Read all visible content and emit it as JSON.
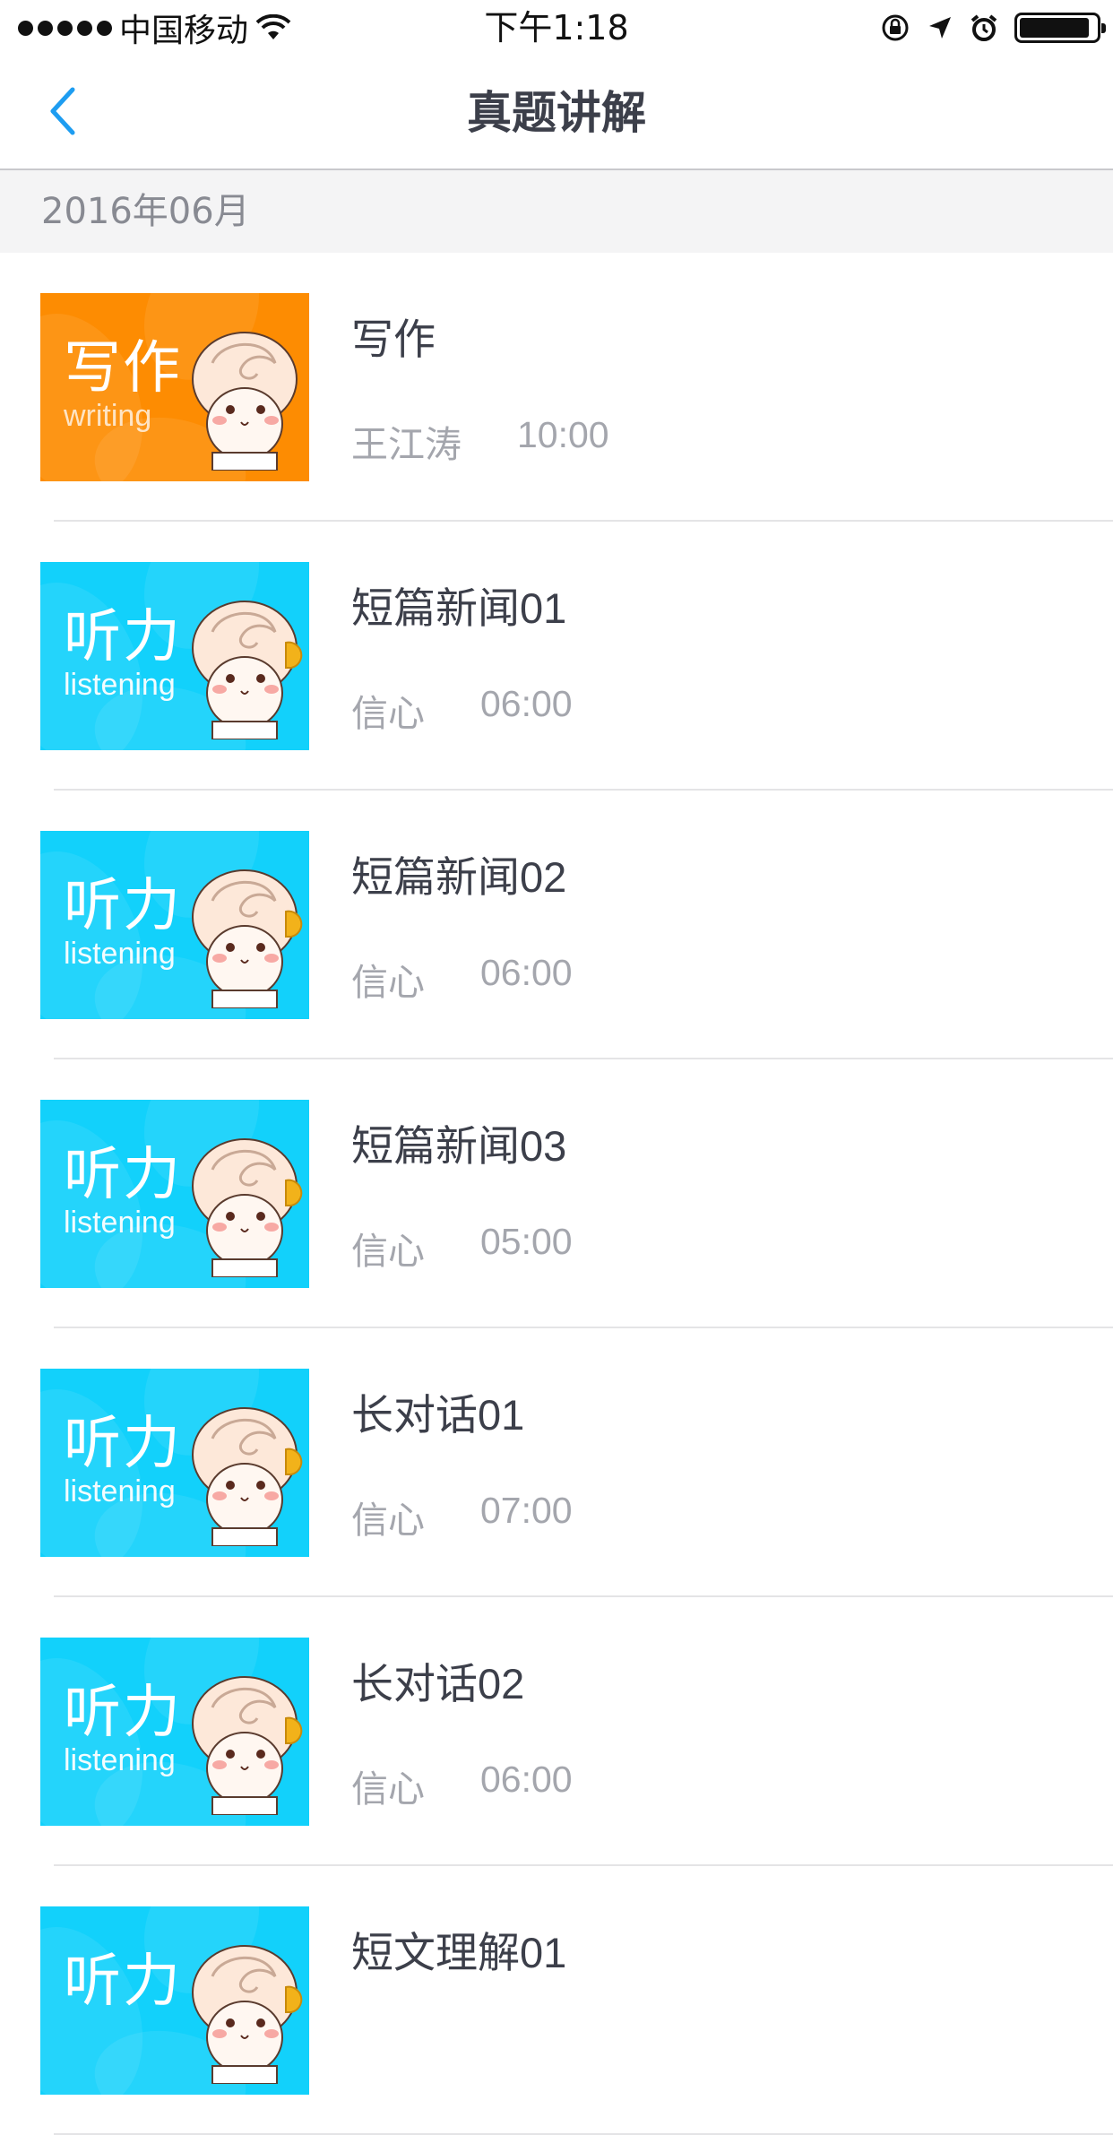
{
  "status_bar": {
    "carrier": "中国移动",
    "time": "下午1:18"
  },
  "nav": {
    "title": "真题讲解",
    "back_icon": "chevron-left-icon"
  },
  "section": {
    "header": "2016年06月"
  },
  "items": [
    {
      "title": "写作",
      "author": "王江涛",
      "duration": "10:00",
      "badge_cn": "写作",
      "badge_en": "writing",
      "color": "#fd8c02"
    },
    {
      "title": "短篇新闻01",
      "author": "信心",
      "duration": "06:00",
      "badge_cn": "听力",
      "badge_en": "listening",
      "color": "#12d1fb"
    },
    {
      "title": "短篇新闻02",
      "author": "信心",
      "duration": "06:00",
      "badge_cn": "听力",
      "badge_en": "listening",
      "color": "#12d1fb"
    },
    {
      "title": "短篇新闻03",
      "author": "信心",
      "duration": "05:00",
      "badge_cn": "听力",
      "badge_en": "listening",
      "color": "#12d1fb"
    },
    {
      "title": "长对话01",
      "author": "信心",
      "duration": "07:00",
      "badge_cn": "听力",
      "badge_en": "listening",
      "color": "#12d1fb"
    },
    {
      "title": "长对话02",
      "author": "信心",
      "duration": "06:00",
      "badge_cn": "听力",
      "badge_en": "listening",
      "color": "#12d1fb"
    },
    {
      "title": "短文理解01",
      "author": "",
      "duration": "",
      "badge_cn": "听力",
      "badge_en": "",
      "color": "#12d1fb"
    }
  ]
}
